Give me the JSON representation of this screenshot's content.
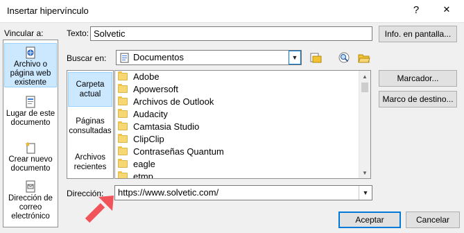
{
  "window": {
    "title": "Insertar hipervínculo",
    "help_label": "?",
    "close_label": "✕"
  },
  "sidebar": {
    "heading": "Vincular a:",
    "items": [
      {
        "label_lines": [
          "Archivo o",
          "página web",
          "existente"
        ],
        "icon": "web-page-icon",
        "selected": true
      },
      {
        "label_lines": [
          "Lugar de este",
          "documento"
        ],
        "icon": "document-place-icon",
        "selected": false
      },
      {
        "label_lines": [
          "Crear nuevo",
          "documento"
        ],
        "icon": "new-document-icon",
        "selected": false
      },
      {
        "label_lines": [
          "Dirección de",
          "correo",
          "electrónico"
        ],
        "icon": "email-icon",
        "selected": false
      }
    ]
  },
  "text_field": {
    "label": "Texto:",
    "value": "Solvetic"
  },
  "screen_tip_button": "Info. en pantalla...",
  "look_in": {
    "label": "Buscar en:",
    "value": "Documentos"
  },
  "subnav": {
    "items": [
      {
        "label_lines": [
          "Carpeta",
          "actual"
        ],
        "selected": true
      },
      {
        "label_lines": [
          "Páginas",
          "consultadas"
        ],
        "selected": false
      },
      {
        "label_lines": [
          "Archivos",
          "recientes"
        ],
        "selected": false
      }
    ]
  },
  "files": [
    "Adobe",
    "Apowersoft",
    "Archivos de Outlook",
    "Audacity",
    "Camtasia Studio",
    "ClipClip",
    "Contraseñas Quantum",
    "eagle",
    "etmp"
  ],
  "bookmark_button": "Marcador...",
  "target_frame_button": "Marco de destino...",
  "address": {
    "label": "Dirección:",
    "value": "https://www.solvetic.com/"
  },
  "ok_button": "Aceptar",
  "cancel_button": "Cancelar",
  "colors": {
    "accent": "#0078d7",
    "selection": "#cce8ff",
    "arrow": "#f0545a"
  }
}
